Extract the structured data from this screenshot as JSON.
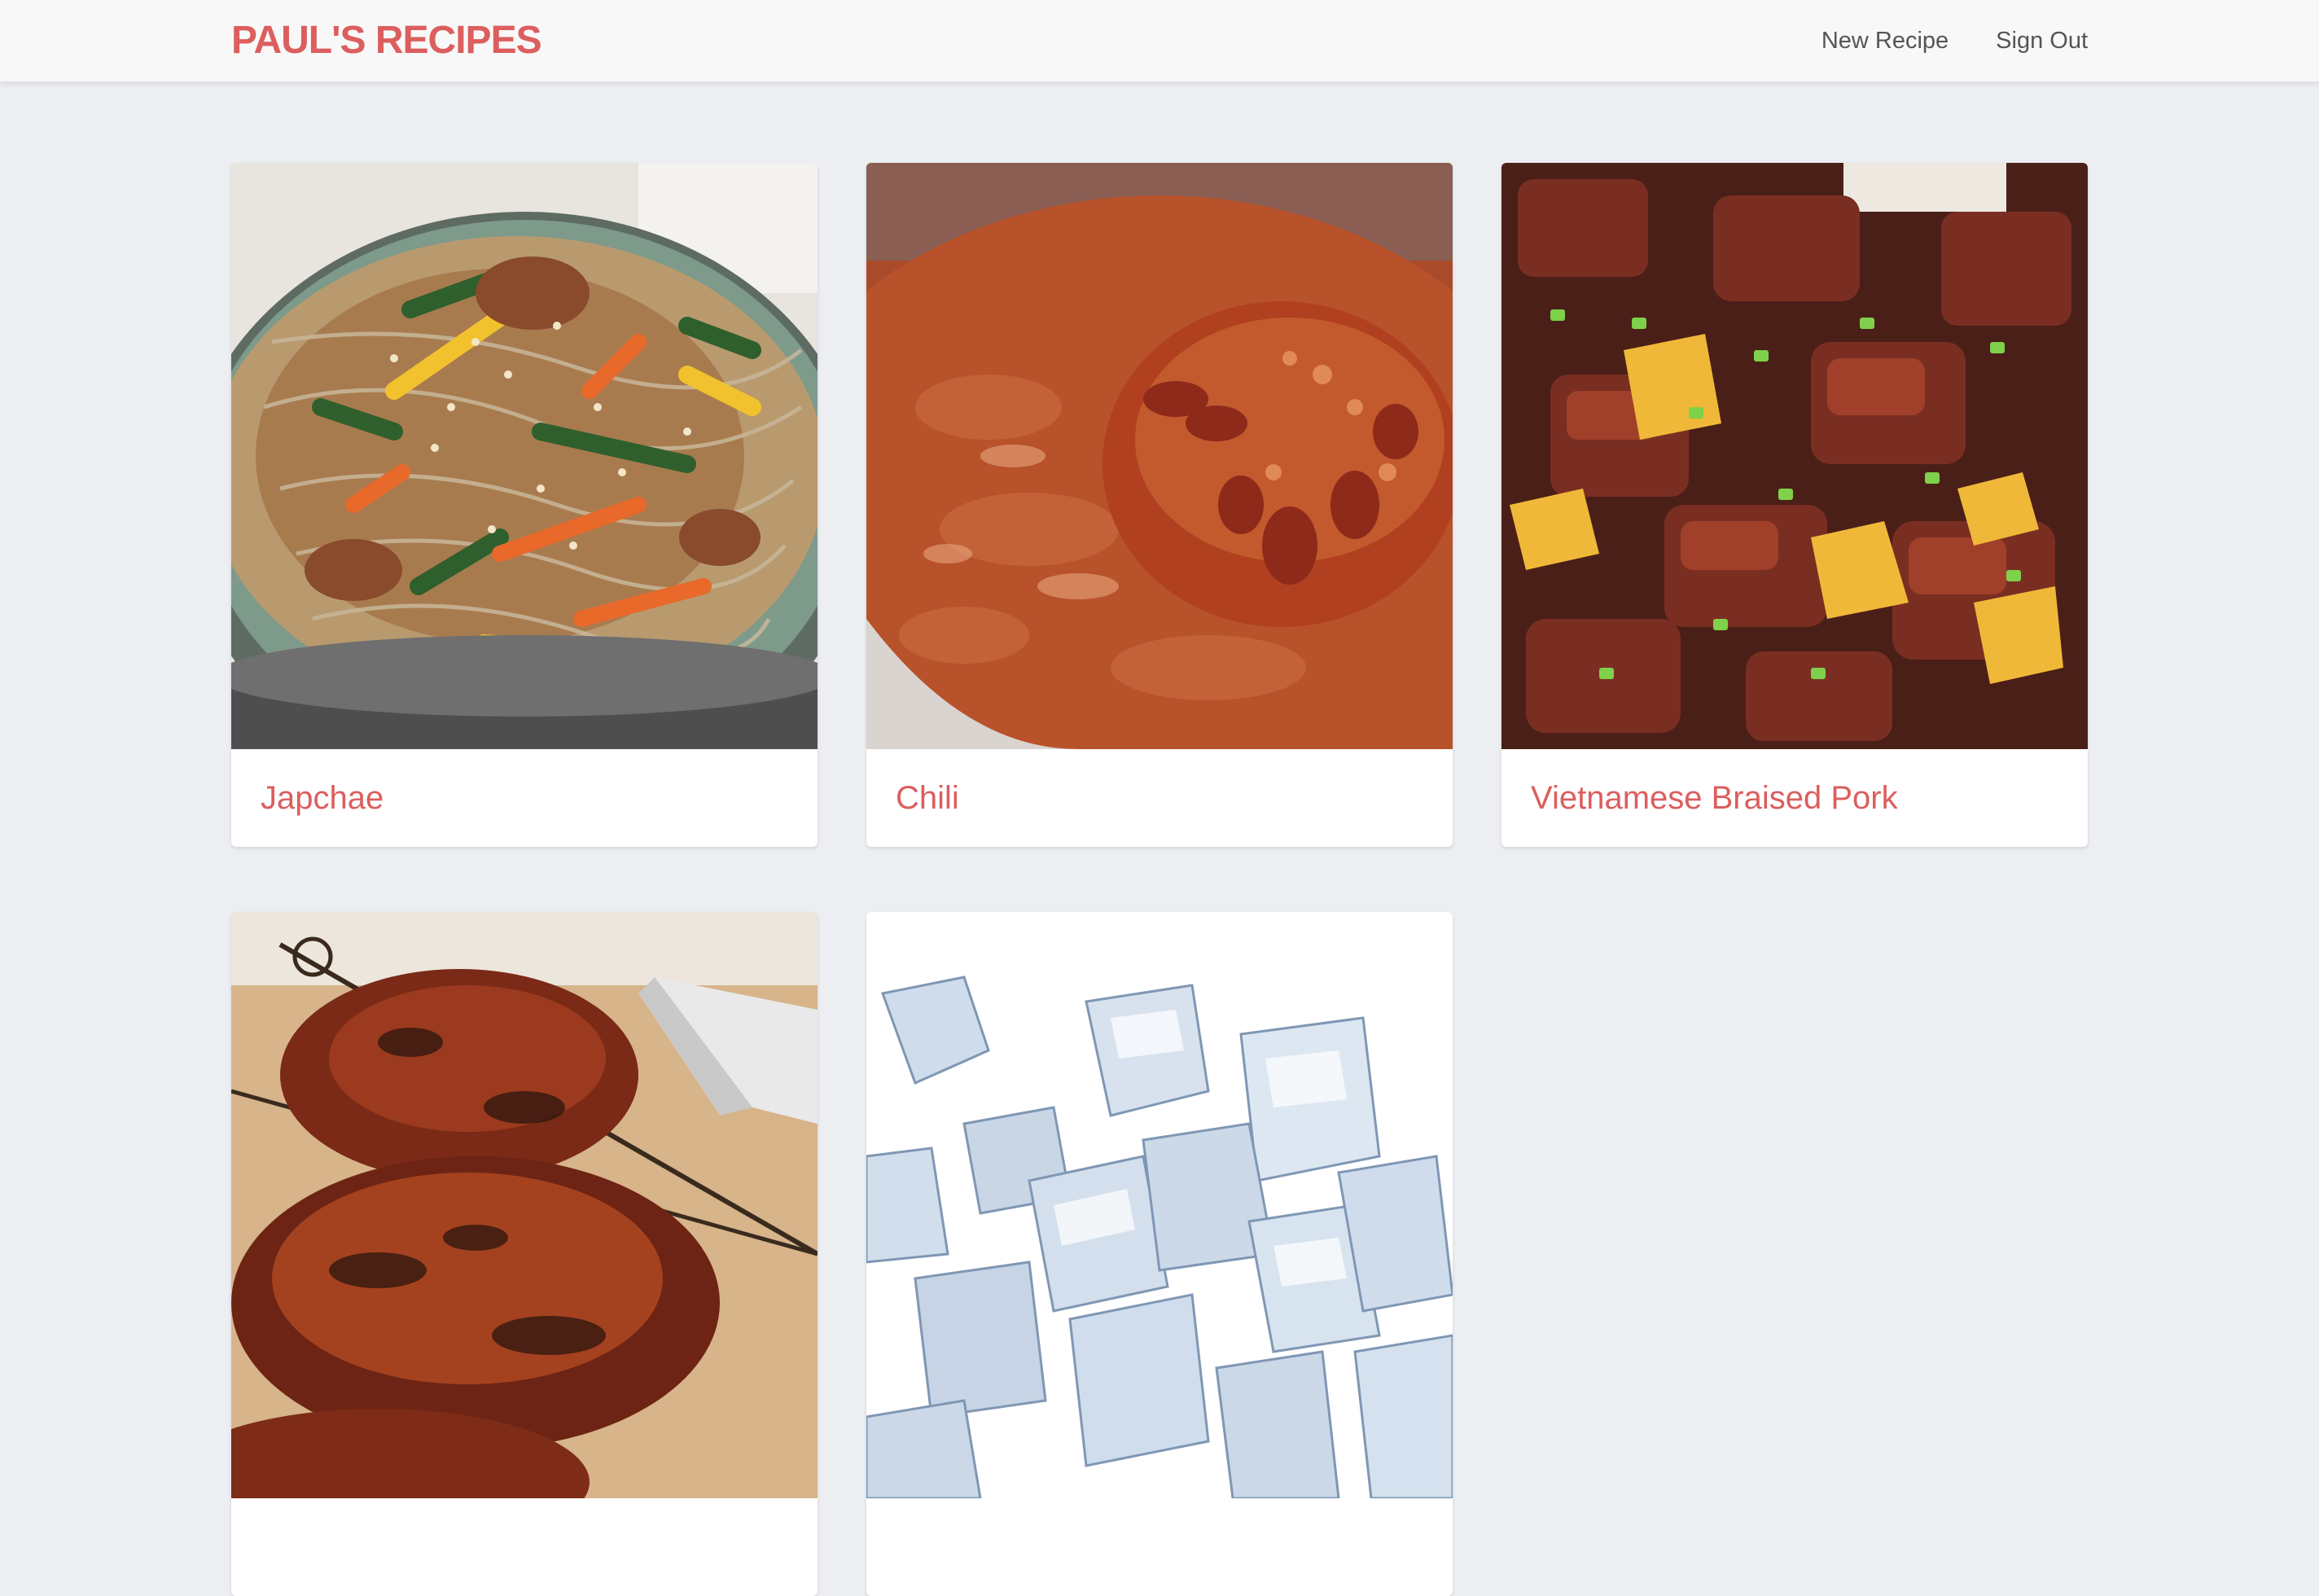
{
  "brand": {
    "name": "PAUL'S RECIPES"
  },
  "nav": {
    "new_recipe": "New Recipe",
    "sign_out": "Sign Out"
  },
  "recipes": [
    {
      "title": "Japchae",
      "image": "japchae-photo"
    },
    {
      "title": "Chili",
      "image": "chili-photo"
    },
    {
      "title": "Vietnamese Braised Pork",
      "image": "braised-pork-photo"
    },
    {
      "title": "",
      "image": "roast-chicken-photo"
    },
    {
      "title": "",
      "image": "ice-cubes-photo"
    }
  ],
  "colors": {
    "accent": "#dc5e5e",
    "background": "#eceef2",
    "navbar": "#f8f8f8",
    "nav_text": "#555555"
  }
}
